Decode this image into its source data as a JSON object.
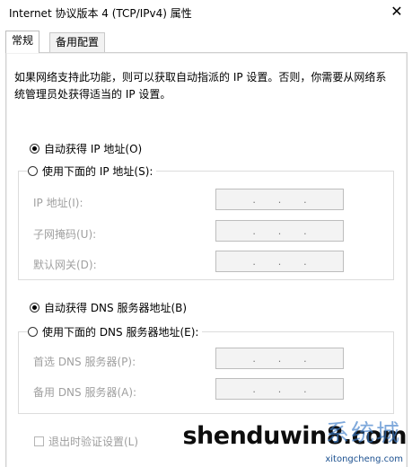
{
  "window": {
    "title": "Internet 协议版本 4 (TCP/IPv4) 属性",
    "close_glyph": "✕"
  },
  "tabs": [
    {
      "label": "常规"
    },
    {
      "label": "备用配置"
    }
  ],
  "description": "如果网络支持此功能，则可以获取自动指派的 IP 设置。否则，你需要从网络系统管理员处获得适当的 IP 设置。",
  "ip": {
    "auto_label": "自动获得 IP 地址(O)",
    "manual_label": "使用下面的 IP 地址(S):",
    "fields": [
      {
        "label": "IP 地址(I):"
      },
      {
        "label": "子网掩码(U):"
      },
      {
        "label": "默认网关(D):"
      }
    ]
  },
  "dns": {
    "auto_label": "自动获得 DNS 服务器地址(B)",
    "manual_label": "使用下面的 DNS 服务器地址(E):",
    "fields": [
      {
        "label": "首选 DNS 服务器(P):"
      },
      {
        "label": "备用 DNS 服务器(A):"
      }
    ]
  },
  "validate_label": "退出时验证设置(L)",
  "watermark": {
    "main": "shenduwin8.com",
    "sub": "xitongcheng.com",
    "cn": "系统城"
  },
  "ip_dots": [
    ".",
    ".",
    "."
  ]
}
